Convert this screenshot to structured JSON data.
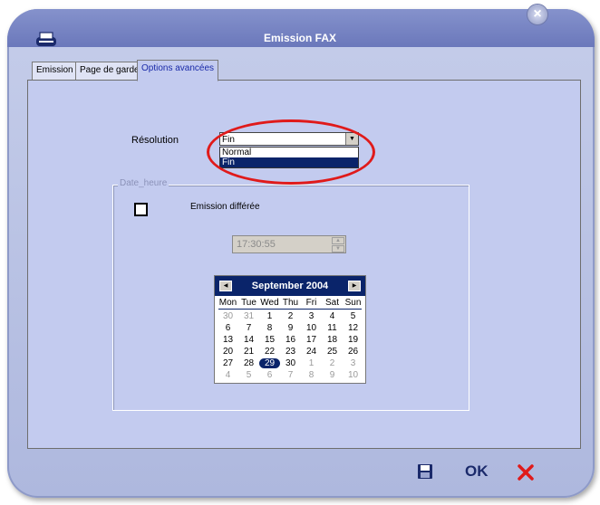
{
  "window": {
    "title": "Emission FAX"
  },
  "tabs": [
    {
      "label": "Emission",
      "active": false
    },
    {
      "label": "Page de garde",
      "active": false
    },
    {
      "label": "Options avancées",
      "active": true
    }
  ],
  "resolution": {
    "label": "Résolution",
    "selected": "Fin",
    "options": [
      "Normal",
      "Fin"
    ],
    "highlighted": "Fin"
  },
  "date_group": {
    "legend": "Date_heure",
    "deferred_label": "Emission différée",
    "deferred_checked": false,
    "time_value": "17:30:55"
  },
  "calendar": {
    "month_label": "September 2004",
    "weekdays": [
      "Mon",
      "Tue",
      "Wed",
      "Thu",
      "Fri",
      "Sat",
      "Sun"
    ],
    "weeks": [
      [
        "30",
        "31",
        "1",
        "2",
        "3",
        "4",
        "5"
      ],
      [
        "6",
        "7",
        "8",
        "9",
        "10",
        "11",
        "12"
      ],
      [
        "13",
        "14",
        "15",
        "16",
        "17",
        "18",
        "19"
      ],
      [
        "20",
        "21",
        "22",
        "23",
        "24",
        "25",
        "26"
      ],
      [
        "27",
        "28",
        "29",
        "30",
        "1",
        "2",
        "3"
      ],
      [
        "4",
        "5",
        "6",
        "7",
        "8",
        "9",
        "10"
      ]
    ],
    "selected_day": "29"
  },
  "footer": {
    "ok_label": "OK"
  },
  "colors": {
    "accent": "#0a246a",
    "highlight_ring": "#e01a1a",
    "panel": "#c3cbef",
    "cancel": "#e01a1a"
  }
}
